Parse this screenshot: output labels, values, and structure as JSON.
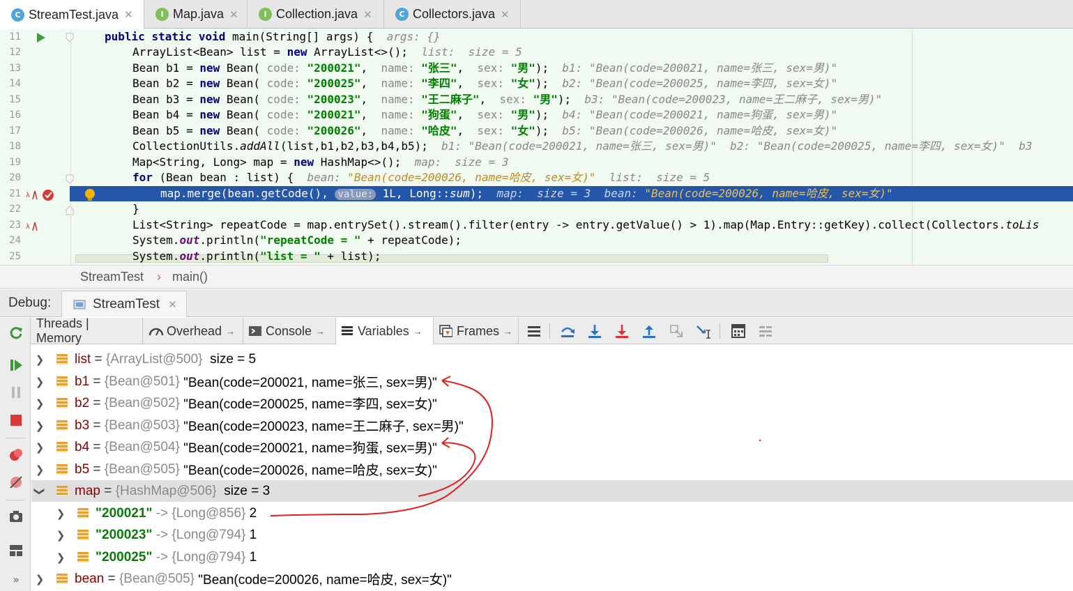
{
  "tabs": [
    {
      "label": "StreamTest.java",
      "icon": "C",
      "active": true
    },
    {
      "label": "Map.java",
      "icon": "I"
    },
    {
      "label": "Collection.java",
      "icon": "I"
    },
    {
      "label": "Collectors.java",
      "icon": "C"
    }
  ],
  "code": {
    "line_numbers": [
      "11",
      "12",
      "13",
      "14",
      "15",
      "16",
      "17",
      "18",
      "19",
      "20",
      "21",
      "22",
      "23",
      "24",
      "25"
    ],
    "l11": {
      "k1": "public",
      "k2": "static",
      "k3": "void",
      "sig": " main(String[] args) {  ",
      "hint": "args: {}"
    },
    "l12": {
      "a": "ArrayList<Bean> list = ",
      "kw": "new",
      "b": " ArrayList<>();  ",
      "hint": "list:  size = 5"
    },
    "l13": {
      "a": "Bean b1 = ",
      "kw": "new",
      "b": " Bean( ",
      "p1": "code: ",
      "v1": "\"200021\"",
      "c1": ",  ",
      "p2": "name: ",
      "v2": "\"张三\"",
      "c2": ",  ",
      "p3": "sex: ",
      "v3": "\"男\"",
      "e": ");  ",
      "hint": "b1: \"Bean(code=200021, name=张三, sex=男)\""
    },
    "l14": {
      "a": "Bean b2 = ",
      "kw": "new",
      "b": " Bean( ",
      "p1": "code: ",
      "v1": "\"200025\"",
      "c1": ",  ",
      "p2": "name: ",
      "v2": "\"李四\"",
      "c2": ",  ",
      "p3": "sex: ",
      "v3": "\"女\"",
      "e": ");  ",
      "hint": "b2: \"Bean(code=200025, name=李四, sex=女)\""
    },
    "l15": {
      "a": "Bean b3 = ",
      "kw": "new",
      "b": " Bean( ",
      "p1": "code: ",
      "v1": "\"200023\"",
      "c1": ",  ",
      "p2": "name: ",
      "v2": "\"王二麻子\"",
      "c2": ",  ",
      "p3": "sex: ",
      "v3": "\"男\"",
      "e": ");  ",
      "hint": "b3: \"Bean(code=200023, name=王二麻子, sex=男)\""
    },
    "l16": {
      "a": "Bean b4 = ",
      "kw": "new",
      "b": " Bean( ",
      "p1": "code: ",
      "v1": "\"200021\"",
      "c1": ",  ",
      "p2": "name: ",
      "v2": "\"狗蛋\"",
      "c2": ",  ",
      "p3": "sex: ",
      "v3": "\"男\"",
      "e": ");  ",
      "hint": "b4: \"Bean(code=200021, name=狗蛋, sex=男)\""
    },
    "l17": {
      "a": "Bean b5 = ",
      "kw": "new",
      "b": " Bean( ",
      "p1": "code: ",
      "v1": "\"200026\"",
      "c1": ",  ",
      "p2": "name: ",
      "v2": "\"哈皮\"",
      "c2": ",  ",
      "p3": "sex: ",
      "v3": "\"女\"",
      "e": ");  ",
      "hint": "b5: \"Bean(code=200026, name=哈皮, sex=女)\""
    },
    "l18": {
      "a": "CollectionUtils.",
      "m": "addAll",
      "b": "(list,b1,b2,b3,b4,b5);  ",
      "hint": "b1: \"Bean(code=200021, name=张三, sex=男)\"  b2: \"Bean(code=200025, name=李四, sex=女)\"  b3"
    },
    "l19": {
      "a": "Map<String, Long> map = ",
      "kw": "new",
      "b": " HashMap<>();  ",
      "hint": "map:  size = 3"
    },
    "l20": {
      "kw": "for",
      "a": " (Bean bean : list) {  ",
      "h1": "bean: ",
      "hv": "\"Bean(code=200026, name=哈皮, sex=女)\"",
      "h2": "  list:  size = 5"
    },
    "l21": {
      "a": "map.merge(bean.getCode(), ",
      "badge": "value:",
      "b": " 1L, Long::",
      "m": "sum",
      "c": ");  ",
      "h1": "map:  size = 3  bean: ",
      "hv": "\"Bean(code=200026, name=哈皮, sex=女)\""
    },
    "l22": {
      "a": "}"
    },
    "l23": {
      "a": "List<String> repeatCode = map.entrySet().stream().filter(entry -> entry.getValue() > 1).map(Map.Entry::getKey).collect(Collectors.",
      "m": "toLis"
    },
    "l24": {
      "a": "System.",
      "f": "out",
      "b": ".println(",
      "s": "\"repeatCode = \"",
      "c": " + repeatCode);"
    },
    "l25": {
      "a": "System.",
      "f": "out",
      "b": ".println(",
      "s": "\"list = \"",
      "c": " + list);"
    }
  },
  "breadcrumb": {
    "class": "StreamTest",
    "method": "main()"
  },
  "debug": {
    "label": "Debug:",
    "session": "StreamTest"
  },
  "toolbar": {
    "threads": "Threads | Memory",
    "overhead": "Overhead",
    "console": "Console",
    "variables": "Variables",
    "frames": "Frames"
  },
  "variables": [
    {
      "name": "list",
      "ref": "{ArrayList@500}",
      "value": "size = 5"
    },
    {
      "name": "b1",
      "ref": "{Bean@501}",
      "value": "\"Bean(code=200021, name=张三, sex=男)\""
    },
    {
      "name": "b2",
      "ref": "{Bean@502}",
      "value": "\"Bean(code=200025, name=李四, sex=女)\""
    },
    {
      "name": "b3",
      "ref": "{Bean@503}",
      "value": "\"Bean(code=200023, name=王二麻子, sex=男)\""
    },
    {
      "name": "b4",
      "ref": "{Bean@504}",
      "value": "\"Bean(code=200021, name=狗蛋, sex=男)\""
    },
    {
      "name": "b5",
      "ref": "{Bean@505}",
      "value": "\"Bean(code=200026, name=哈皮, sex=女)\""
    },
    {
      "name": "map",
      "ref": "{HashMap@506}",
      "value": "size = 3"
    },
    {
      "name": "\"200021\"",
      "ref": "{Long@856}",
      "value": "2"
    },
    {
      "name": "\"200023\"",
      "ref": "{Long@794}",
      "value": "1"
    },
    {
      "name": "\"200025\"",
      "ref": "{Long@794}",
      "value": "1"
    },
    {
      "name": "bean",
      "ref": "{Bean@505}",
      "value": "\"Bean(code=200026, name=哈皮, sex=女)\""
    }
  ],
  "colors": {
    "highlight": "#2456aa",
    "annotation": "#e02020",
    "editor_bg": "#f0faf0"
  }
}
